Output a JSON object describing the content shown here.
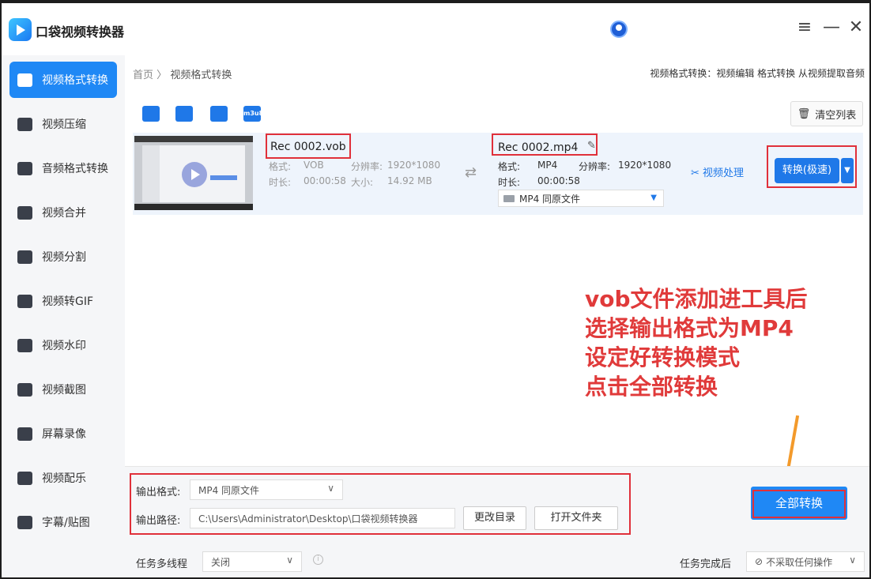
{
  "app": {
    "title": "口袋视频转换器"
  },
  "sidebar": {
    "items": [
      {
        "label": "视频格式转换",
        "active": true
      },
      {
        "label": "视频压缩"
      },
      {
        "label": "音频格式转换"
      },
      {
        "label": "视频合并"
      },
      {
        "label": "视频分割"
      },
      {
        "label": "视频转GIF"
      },
      {
        "label": "视频水印"
      },
      {
        "label": "视频截图"
      },
      {
        "label": "屏幕录像"
      },
      {
        "label": "视频配乐"
      },
      {
        "label": "字幕/贴图"
      }
    ]
  },
  "breadcrumb": {
    "home": "首页",
    "sep": "〉",
    "current": "视频格式转换"
  },
  "header_links": "视频格式转换：视频编辑 格式转换 从视频提取音频",
  "toolbar": {
    "icons": [
      "add-file-icon",
      "add-folder-icon",
      "batch-icon",
      "m3u8-icon"
    ],
    "m3u8_text": "m3u8",
    "clear_label": "清空列表"
  },
  "file": {
    "source": {
      "name": "Rec 0002.vob",
      "format_label": "格式:",
      "format": "VOB",
      "res_label": "分辨率:",
      "resolution": "1920*1080",
      "dur_label": "时长:",
      "duration": "00:00:58",
      "size_label": "大小:",
      "size": "14.92 MB"
    },
    "target": {
      "name": "Rec 0002.mp4",
      "format_label": "格式:",
      "format": "MP4",
      "res_label": "分辨率:",
      "resolution": "1920*1080",
      "dur_label": "时长:",
      "duration": "00:00:58",
      "preset": "MP4  同原文件"
    },
    "process_label": "视频处理",
    "convert_label": "转换(极速)"
  },
  "annotation": [
    "vob文件添加进工具后",
    "选择输出格式为MP4",
    "设定好转换模式",
    "点击全部转换"
  ],
  "bottom": {
    "output_format_label": "输出格式:",
    "output_format": "MP4  同原文件",
    "output_path_label": "输出路径:",
    "output_path": "C:\\Users\\Administrator\\Desktop\\口袋视频转换器",
    "change_dir": "更改目录",
    "open_folder": "打开文件夹",
    "convert_all": "全部转换",
    "multithread_label": "任务多线程",
    "multithread": "关闭",
    "after_label": "任务完成后",
    "after": "不采取任何操作"
  },
  "colors": {
    "accent": "#1f88f5",
    "annotation": "#e03a3a",
    "arrow": "#f39a2b"
  }
}
